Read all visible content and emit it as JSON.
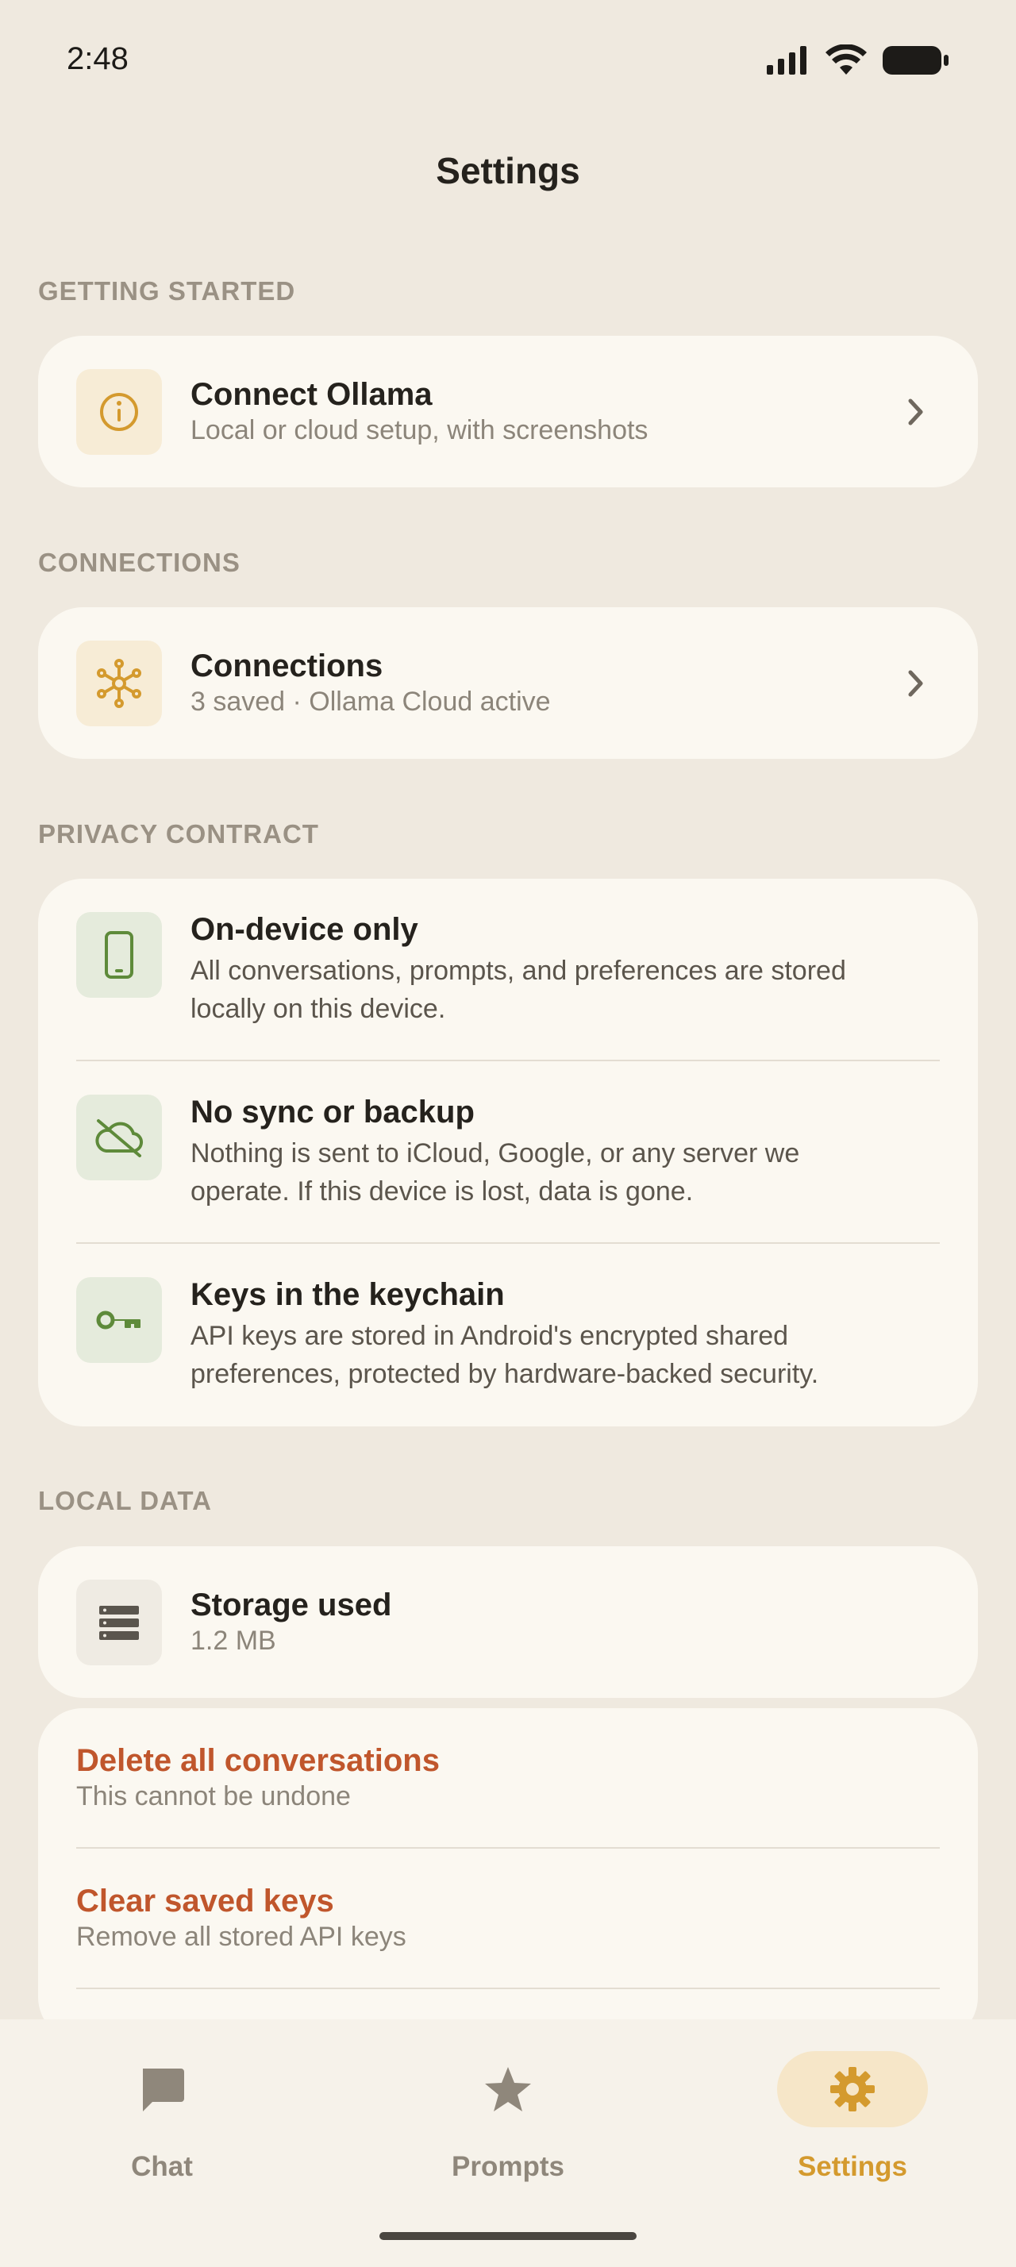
{
  "status": {
    "time": "2:48"
  },
  "page": {
    "title": "Settings"
  },
  "sections": {
    "getting_started": "GETTING STARTED",
    "connections": "CONNECTIONS",
    "privacy": "PRIVACY CONTRACT",
    "local_data": "LOCAL DATA"
  },
  "connect_ollama": {
    "title": "Connect Ollama",
    "subtitle": "Local or cloud setup, with screenshots",
    "icon": "info-icon"
  },
  "connections": {
    "title": "Connections",
    "subtitle": "3 saved · Ollama Cloud active",
    "icon": "network-icon"
  },
  "privacy": {
    "items": [
      {
        "title": "On-device only",
        "desc_line1": "All conversations, prompts, and preferences are stored",
        "desc_line2": "locally on this device.",
        "icon": "phone-icon"
      },
      {
        "title": "No sync or backup",
        "desc_line1": "Nothing is sent to iCloud, Google, or any server we",
        "desc_line2": "operate. If this device is lost, data is gone.",
        "icon": "cloud-off-icon"
      },
      {
        "title": "Keys in the keychain",
        "desc_line1": "API keys are stored in Android's encrypted shared",
        "desc_line2": "preferences, protected by hardware-backed security.",
        "icon": "key-icon"
      }
    ]
  },
  "storage": {
    "title": "Storage used",
    "value": "1.2 MB",
    "icon": "storage-icon"
  },
  "danger": {
    "delete_title": "Delete all conversations",
    "delete_sub": "This cannot be undone",
    "clear_title": "Clear saved keys",
    "clear_sub": "Remove all stored API keys"
  },
  "nav": {
    "items": [
      {
        "label": "Chat",
        "icon": "chat-icon"
      },
      {
        "label": "Prompts",
        "icon": "star-icon"
      },
      {
        "label": "Settings",
        "icon": "gear-icon",
        "active": true
      }
    ]
  },
  "colors": {
    "accent": "#d49a2e",
    "danger": "#c0562c",
    "green": "#5e8a3a",
    "background": "#efe9df",
    "card": "#fbf8f1"
  }
}
